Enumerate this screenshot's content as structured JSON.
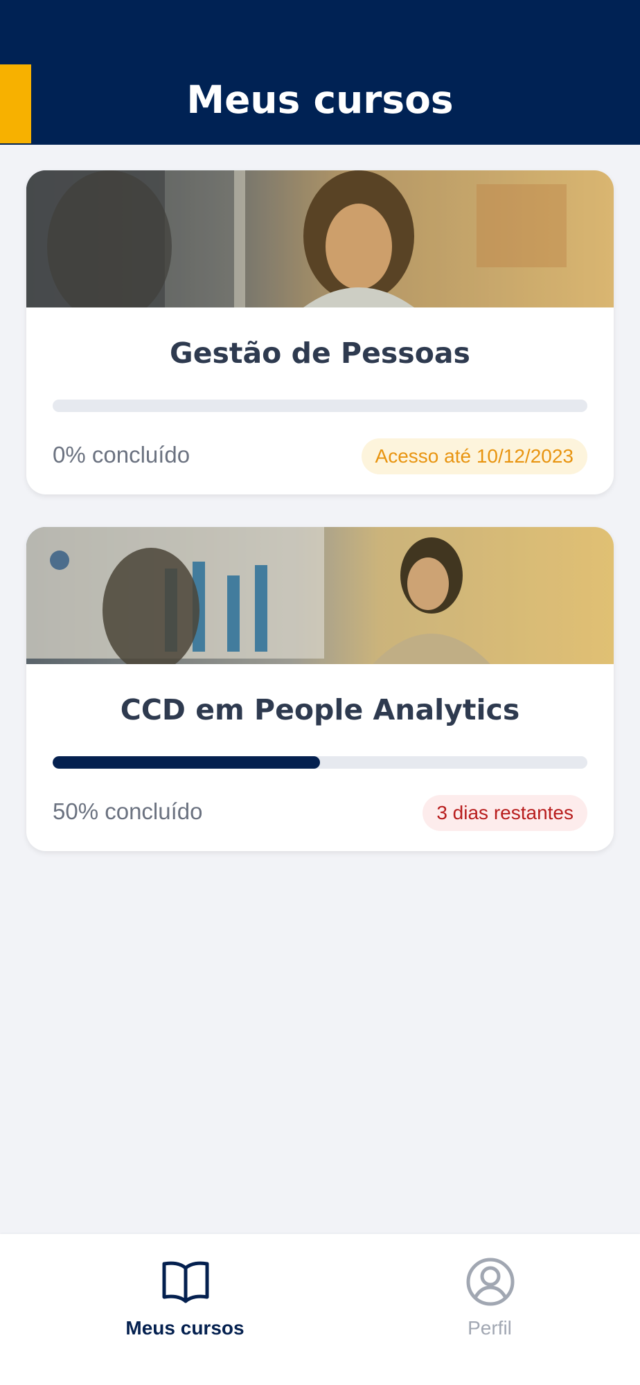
{
  "header": {
    "title": "Meus cursos"
  },
  "colors": {
    "header_bg": "#002254",
    "accent": "#f7b100",
    "progress_fill": "#04204f",
    "badge_warn_text": "#e89410",
    "badge_alert_text": "#b81d1d"
  },
  "courses": [
    {
      "title": "Gestão de Pessoas",
      "image": "presenter-woman-photo",
      "progress_pct": 0,
      "progress_label": "0% concluído",
      "badge": "Acesso até 10/12/2023",
      "badge_type": "warning"
    },
    {
      "title": "CCD em People Analytics",
      "image": "analytics-presentation-photo",
      "progress_pct": 50,
      "progress_label": "50% concluído",
      "badge": "3 dias restantes",
      "badge_type": "alert"
    }
  ],
  "bottom_nav": {
    "items": [
      {
        "label": "Meus cursos",
        "icon": "book-open-icon",
        "active": true
      },
      {
        "label": "Perfil",
        "icon": "user-circle-icon",
        "active": false
      }
    ]
  }
}
